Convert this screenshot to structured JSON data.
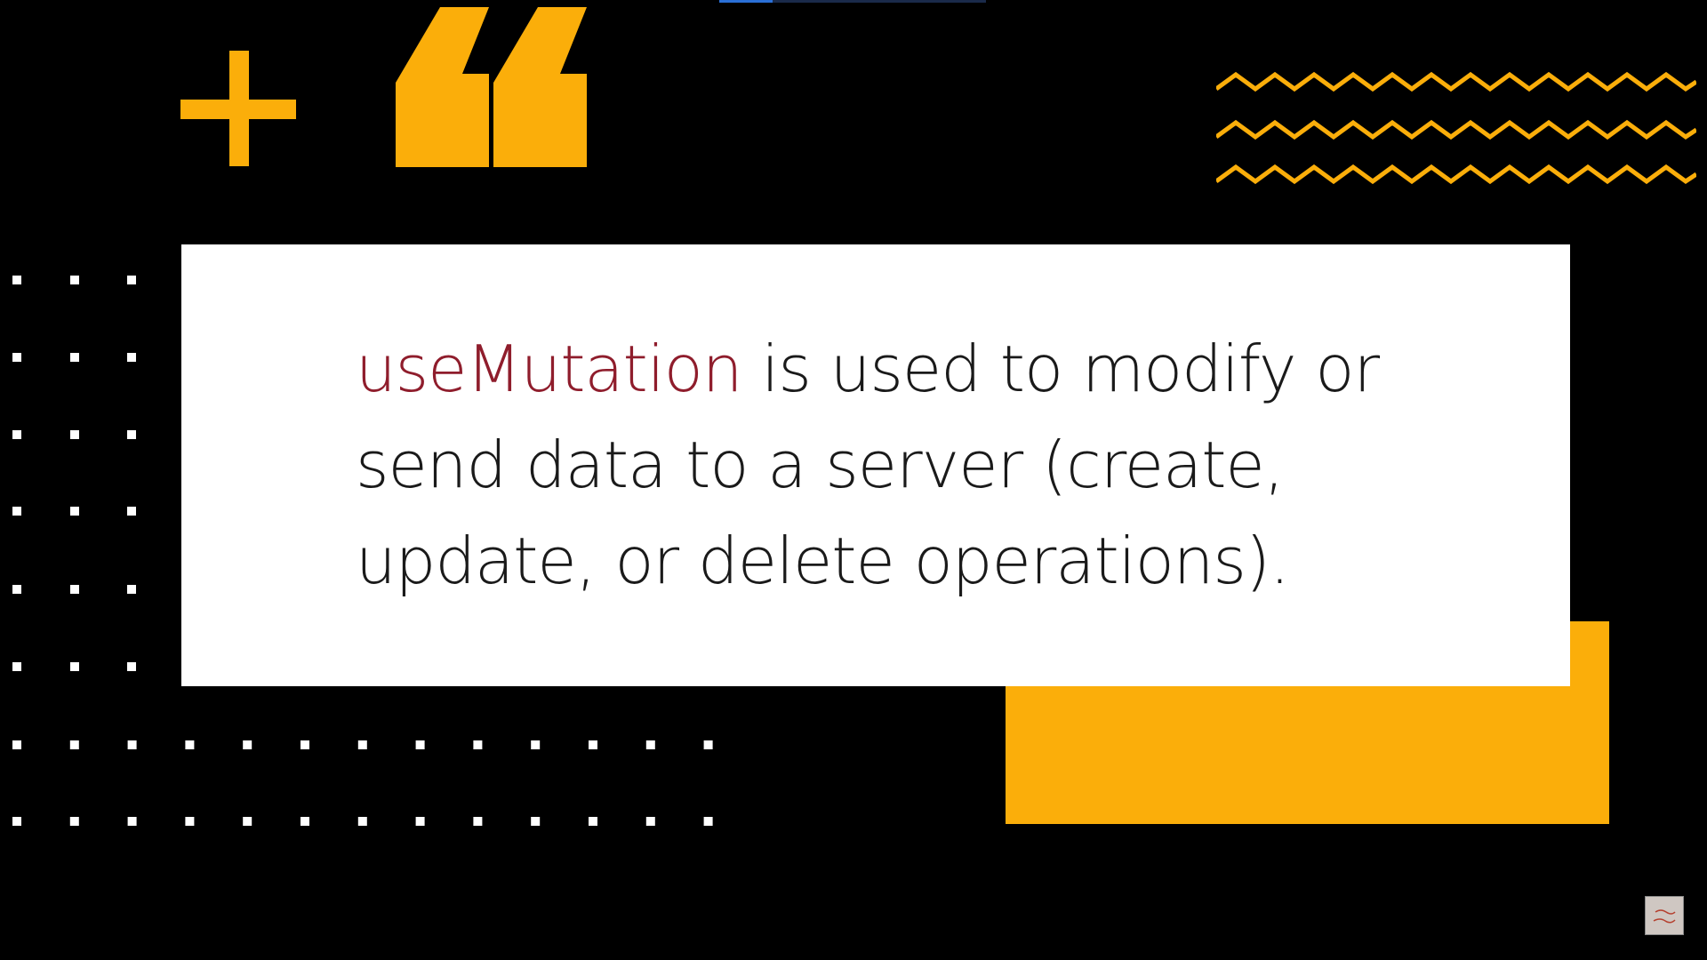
{
  "quote": {
    "keyword": "useMutation",
    "line1_rest": " is used to modify or",
    "line2": "send data to a server (create,",
    "line3": "update, or delete operations)."
  },
  "colors": {
    "background": "#000000",
    "accent": "#fbae0a",
    "card": "#ffffff",
    "keyword": "#8f1d2c",
    "text": "#1a1a1a",
    "dots": "#ffffff"
  },
  "decorations": {
    "plus": "plus-icon",
    "quote_mark": "quote-mark-icon",
    "zigzag": "zigzag-icon",
    "dots": "dot-grid",
    "watermark": "channel-logo-icon"
  }
}
